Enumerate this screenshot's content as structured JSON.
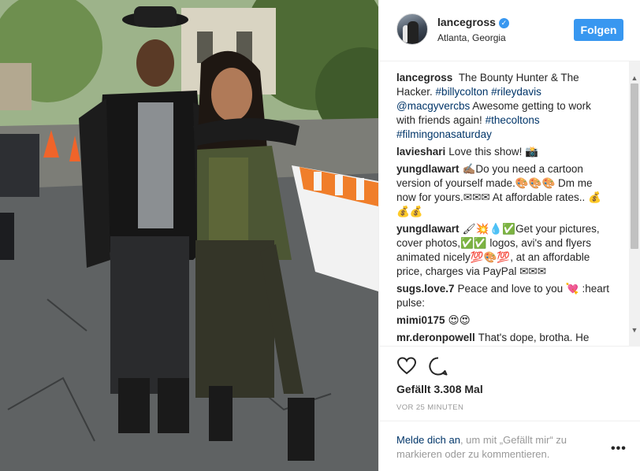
{
  "post": {
    "username": "lancegross",
    "location": "Atlanta, Georgia",
    "follow_label": "Folgen",
    "likes": "Gefällt 3.308 Mal",
    "time_ago": "VOR 25 MINUTEN",
    "login_link": "Melde dich an",
    "login_rest": ", um mit „Gefällt mir“ zu markieren oder zu kommentieren.",
    "more": "•••"
  },
  "icons": {
    "verified": "verified-badge-icon",
    "heart": "heart-icon",
    "comment": "comment-bubble-icon",
    "more": "more-options-icon",
    "scroll_up": "scroll-up-arrow-icon",
    "scroll_down": "scroll-down-arrow-icon"
  },
  "colors": {
    "accent": "#3897f0",
    "link": "#003569",
    "text": "#262626",
    "muted": "#999999"
  },
  "caption": {
    "author": "lancegross",
    "text_1": "The Bounty Hunter & The Hacker.",
    "tag_1": "#billycolton",
    "tag_2": "#rileydavis",
    "mention": "@macgyvercbs",
    "text_2": "Awesome getting to work with friends again!",
    "tag_3": "#thecoltons",
    "tag_4": "#filmingonasaturday"
  },
  "comments": [
    {
      "author": "lavieshari",
      "text": "Love this show! 📸"
    },
    {
      "author": "yungdlawart",
      "text": "✍🏽Do you need a cartoon version of yourself made.🎨🎨🎨 Dm me now for yours.✉✉✉ At affordable rates.. 💰💰💰"
    },
    {
      "author": "yungdlawart",
      "text": "🖌💥💧✅Get your pictures, cover photos,✅✅ logos, avi's and flyers animated nicely💯🎨💯, at an affordable price, charges via PayPal ✉✉✉"
    },
    {
      "author": "sugs.love.7",
      "text": "Peace and love to you 💘 :heart pulse:"
    },
    {
      "author": "mimi0175",
      "text": "😍😍"
    },
    {
      "author": "mr.deronpowell",
      "text": "That's dope, brotha. He"
    }
  ]
}
